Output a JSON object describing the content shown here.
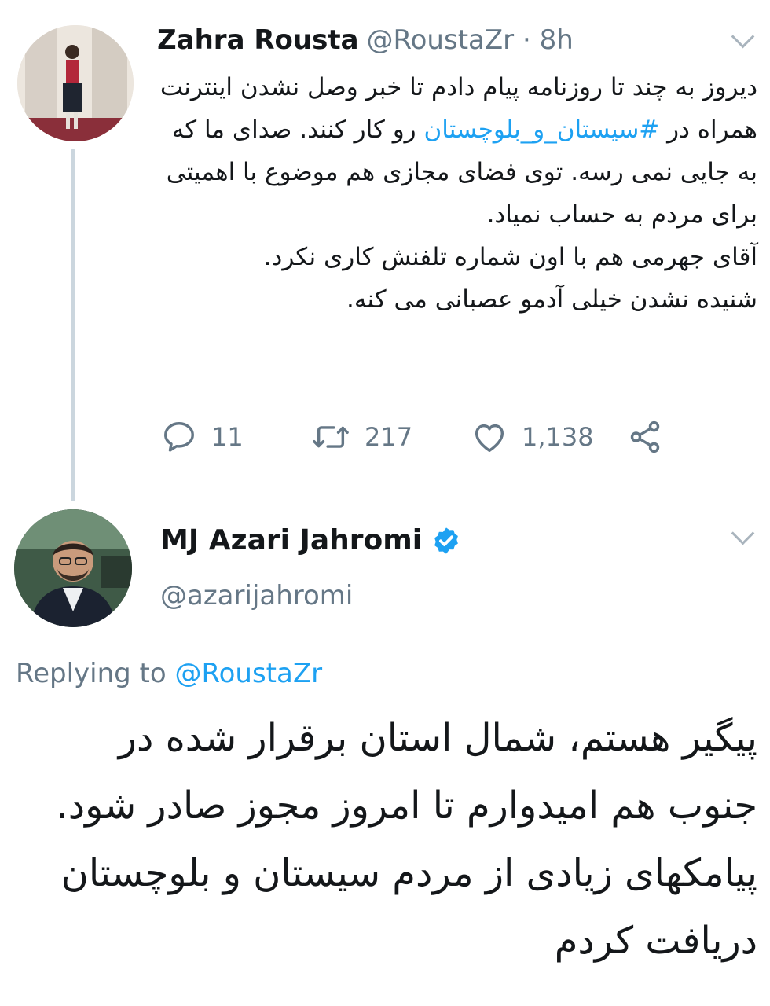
{
  "tweet1": {
    "name": "Zahra Rousta",
    "handle": "@RoustaZr",
    "separator": "·",
    "time": "8h",
    "text_before_tag": "دیروز به چند تا روزنامه پیام دادم تا خبر وصل نشدن اینترنت همراه در ",
    "hashtag": "#سیستان_و_بلوچستان",
    "text_after_tag": " رو کار کنند. صدای ما که به جایی نمی رسه. توی فضای مجازی هم موضوع با اهمیتی برای مردم به حساب نمیاد.",
    "text_line2": "آقای جهرمی هم با اون شماره تلفنش کاری نکرد.",
    "text_line3": "شنیده نشدن خیلی آدمو عصبانی می کنه.",
    "stats": {
      "replies": "11",
      "retweets": "217",
      "likes": "1,138"
    }
  },
  "tweet2": {
    "name": "MJ Azari Jahromi",
    "handle": "@azarijahromi",
    "replying_prefix": "Replying to ",
    "replying_handle": "@RoustaZr",
    "text": "پیگیر هستم، شمال استان برقرار شده در جنوب هم امیدوارم تا امروز مجوز صادر شود. پیامکهای زیادی از مردم سیستان و بلوچستان دریافت کردم"
  },
  "colors": {
    "link": "#1da1f2",
    "muted": "#657786",
    "verified": "#1da1f2"
  }
}
